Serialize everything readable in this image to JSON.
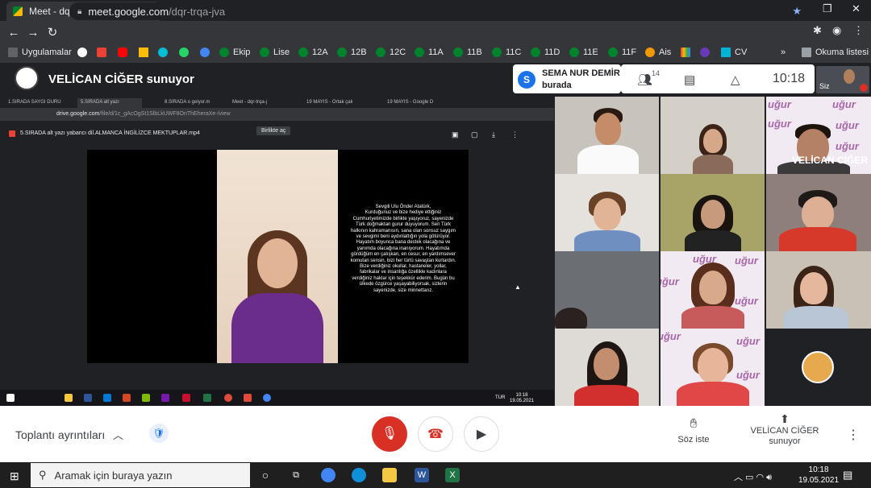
{
  "chrome": {
    "tab_title": "Meet - dqr-trqa-jva",
    "url_host": "meet.google.com",
    "url_path": "/dqr-trqa-jva"
  },
  "bookmarks": {
    "items": [
      "Uygulamalar",
      "Ekip",
      "Lise",
      "12A",
      "12B",
      "12C",
      "11A",
      "11B",
      "11C",
      "11D",
      "11E",
      "11F",
      "Ais",
      "CV"
    ],
    "reading_list": "Okuma listesi"
  },
  "meet": {
    "presenting": "VELİCAN CİĞER sunuyor",
    "toast_initial": "S",
    "toast_name": "SEMA NUR DEMİR",
    "toast_status": "burada",
    "participant_count": "14",
    "clock": "10:18",
    "self_label": "Siz"
  },
  "shared": {
    "tabs": [
      "1.SIRADA SAYGI DURU",
      "5.SIRADA alt yazı",
      "8.SIRADA o gelyor.m",
      "Meet - dqr-trqa-j",
      "19 MAYIS - Ortak çalı",
      "19 MAYIS - Google D"
    ],
    "url_host": "drive.google.com",
    "url_path": "/file/d/1c_gAcOgSt1SlbLkUWF8OnThEheraXe-/view",
    "file_name": "5.SIRADA alt yazı yabancı dil.ALMANCA İNGİLİZCE MEKTUPLAR.mp4",
    "open_with": "Birlikte aç",
    "letter_lines": [
      "Sevgili Ulu Önder Atatürk,",
      "Kurduğunuz ve bize hediye ettiğiniz",
      "Cumhuriyetimizde birlikte yaşıyoruz, sayenizde",
      "Türk doğmaktan gurur duyuyorum. Sen Türk",
      "halkının kahramanısın, sana olan sonsuz saygım",
      "ve sevgimi beni aydınlattığın yola götürüyor.",
      "Hayatım boyunca bana destek olacağına ve",
      "yanımda olacağına inanıyorum. Hayatımda",
      "gördüğüm en çalışkan, en cesur, en yardımsever",
      "komutan sensin, bizi her türlü savaştan kurtardın.",
      "Bize verdiğiniz okullar, hastaneler, yollar,",
      "fabrikalar ve insanlığa özellikle kadınlara",
      "verdiğiniz haklar için teşekkür ederim. Bugün bu",
      "ülkede özgürce yaşayabiliyorsak, sizlerin",
      "sayenizde, size minnettarız."
    ],
    "taskbar_lang": "TUR",
    "taskbar_time": "10:18",
    "taskbar_date": "19.05.2021"
  },
  "grid": {
    "watermark": "uğur",
    "presenter_name": "VELİCAN CİĞER"
  },
  "controls": {
    "meeting_details": "Toplantı ayrıntıları",
    "raise_hand": "Söz iste",
    "presenting_line1": "VELİCAN CİĞER",
    "presenting_line2": "sunuyor"
  },
  "taskbar": {
    "search_placeholder": "Aramak için buraya yazın",
    "time": "10:18",
    "date": "19.05.2021"
  },
  "colors": {
    "end_call": "#d93025",
    "mic_off": "#d93025",
    "dark_bg": "#202124",
    "ugur_purple": "#8e3a8e"
  }
}
